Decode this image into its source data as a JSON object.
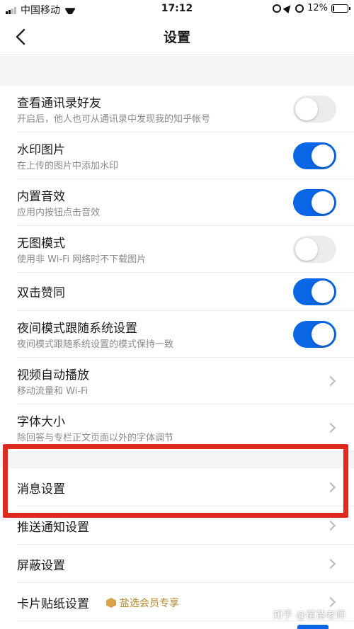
{
  "status_bar": {
    "carrier": "中国移动",
    "time": "17:12",
    "battery_text": "12%",
    "battery_level": 0.12
  },
  "nav": {
    "title": "设置"
  },
  "settings": [
    {
      "title": "查看通讯录好友",
      "subtitle": "开启后，他人也可从通讯录中发现我的知乎帐号",
      "control": "toggle",
      "on": false
    },
    {
      "title": "水印图片",
      "subtitle": "在上传的图片中添加水印",
      "control": "toggle",
      "on": true
    },
    {
      "title": "内置音效",
      "subtitle": "应用内按钮点击音效",
      "control": "toggle",
      "on": true
    },
    {
      "title": "无图模式",
      "subtitle": "使用非 Wi-Fi 网络时不下载图片",
      "control": "toggle",
      "on": false
    },
    {
      "title": "双击赞同",
      "subtitle": "",
      "control": "toggle",
      "on": true
    },
    {
      "title": "夜间模式跟随系统设置",
      "subtitle": "夜间模式跟随系统设置的模式保持一致",
      "control": "toggle",
      "on": true
    },
    {
      "title": "视频自动播放",
      "subtitle": "移动流量和 Wi-Fi",
      "control": "chevron"
    },
    {
      "title": "字体大小",
      "subtitle": "除回答与专栏正文页面以外的字体调节",
      "control": "chevron"
    }
  ],
  "settings2": [
    {
      "title": "消息设置",
      "control": "chevron"
    },
    {
      "title": "推送通知设置",
      "control": "chevron"
    },
    {
      "title": "屏蔽设置",
      "control": "chevron"
    },
    {
      "title": "卡片贴纸设置",
      "control": "chevron",
      "badge": "盐选会员专享"
    }
  ],
  "watermark": "知乎 @苗苗老师",
  "colors": {
    "toggle_on": "#0a66e4",
    "toggle_off": "#ececec",
    "highlight": "#e02a1f",
    "badge": "#b9862a"
  }
}
